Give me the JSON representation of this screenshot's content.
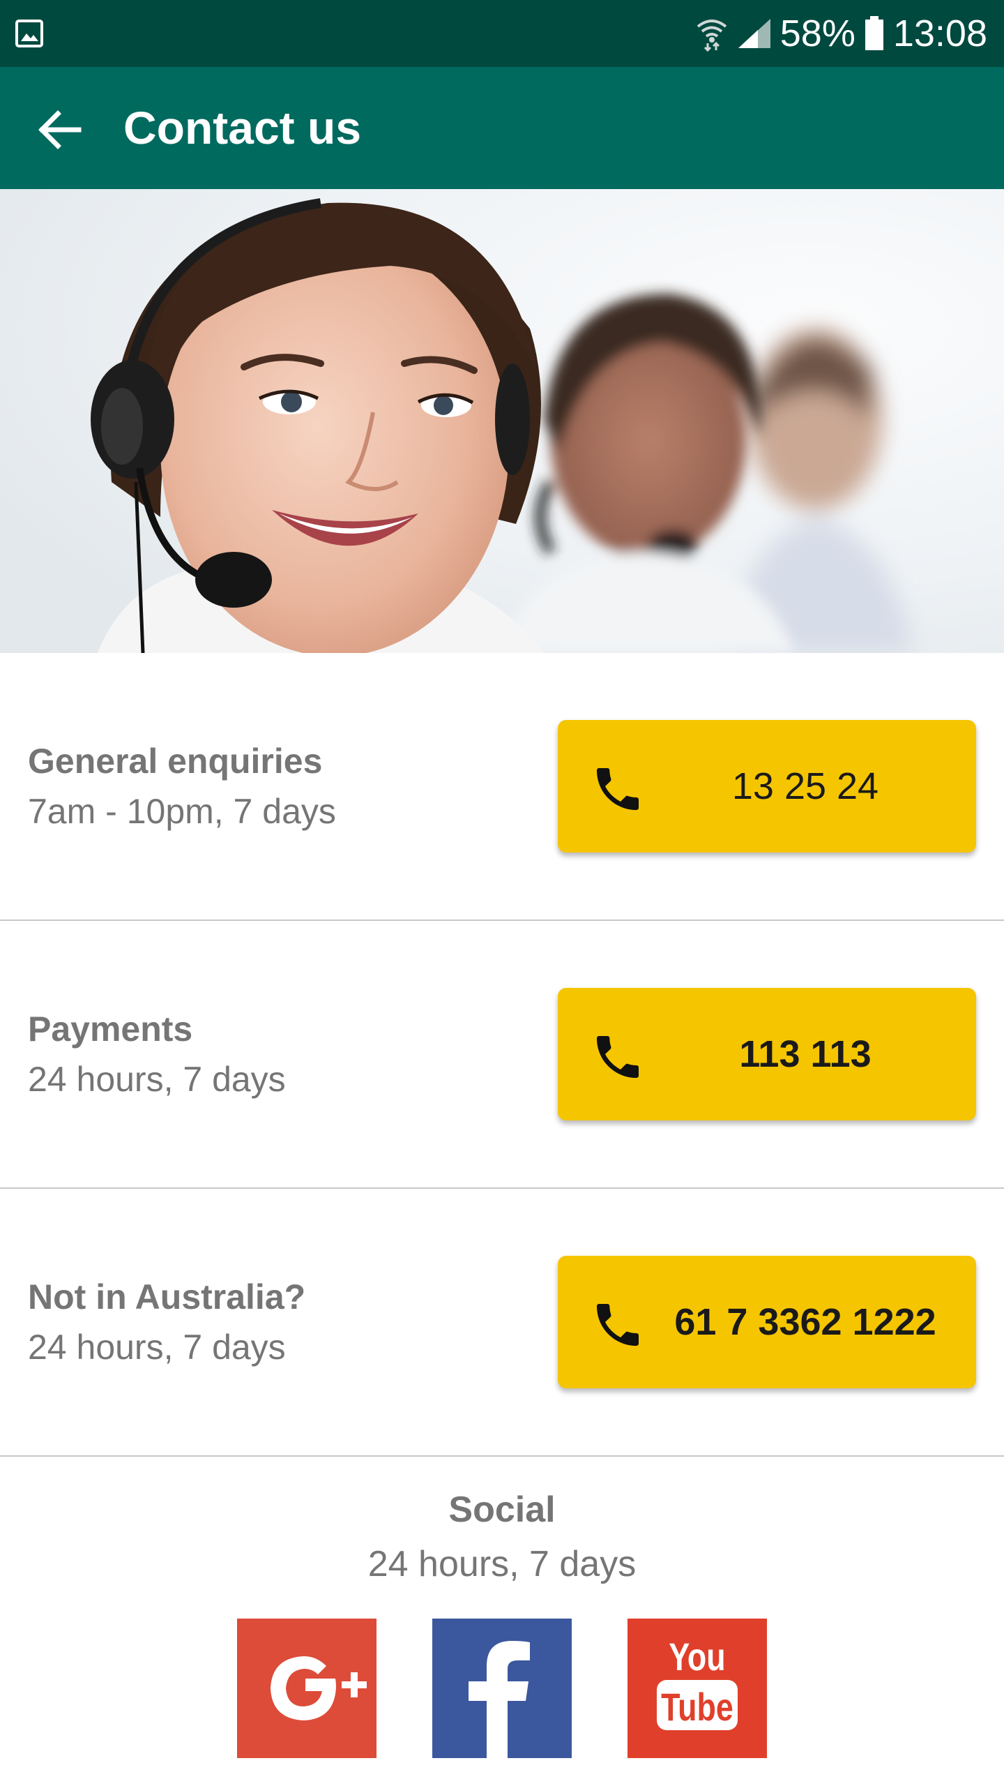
{
  "status_bar": {
    "battery": "58%",
    "time": "13:08",
    "icons": [
      "image-icon",
      "wifi-icon",
      "signal-icon",
      "battery-icon"
    ]
  },
  "app_bar": {
    "title": "Contact us",
    "back_icon": "back-arrow-icon",
    "background": "#006a5f"
  },
  "hero": {
    "description_icon": "photo"
  },
  "contacts": [
    {
      "title": "General enquiries",
      "hours": "7am - 10pm, 7 days",
      "number": "13 25 24"
    },
    {
      "title": "Payments",
      "hours": "24 hours, 7 days",
      "number": "113 113"
    },
    {
      "title": "Not in Australia?",
      "hours": "24 hours, 7 days",
      "number": "61 7 3362 1222"
    }
  ],
  "social": {
    "title": "Social",
    "hours": "24 hours, 7 days",
    "networks": [
      {
        "name": "google-plus",
        "color": "#dd4b39"
      },
      {
        "name": "facebook",
        "color": "#3b579d"
      },
      {
        "name": "youtube",
        "color": "#e0402b"
      }
    ]
  },
  "colors": {
    "status_bar": "#00493f",
    "button": "#f5c500",
    "text_grey": "#757575"
  }
}
